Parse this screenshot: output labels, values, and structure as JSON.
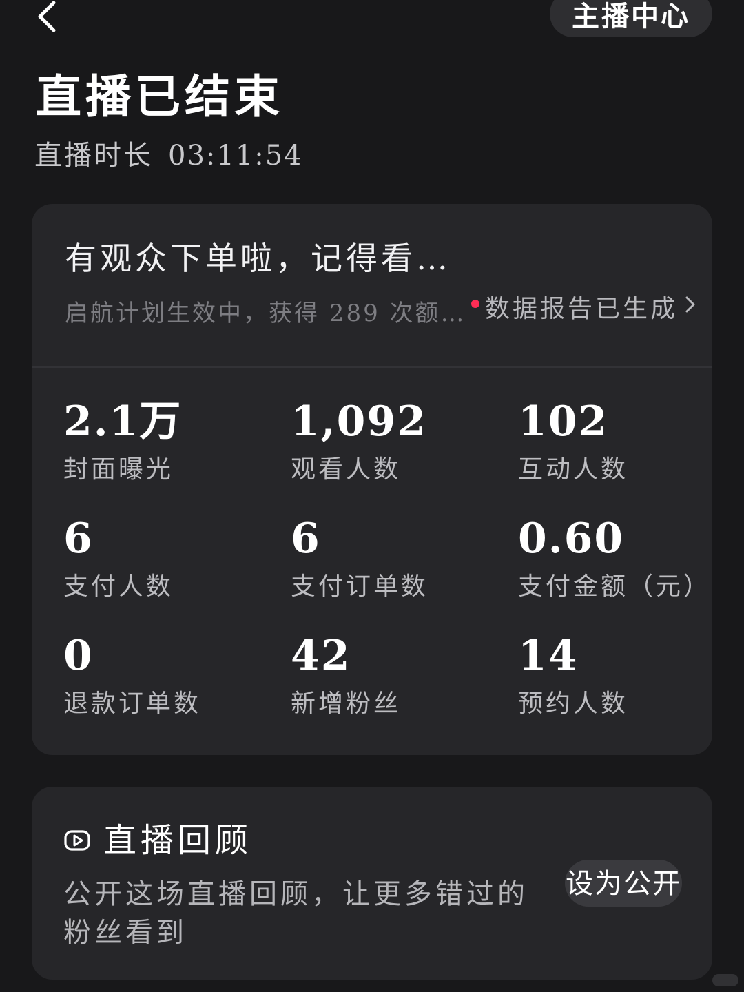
{
  "header": {
    "back_icon": "chevron-left-icon",
    "anchor_center_label": "主播中心"
  },
  "summary": {
    "title": "直播已结束",
    "duration_label": "直播时长",
    "duration_value": "03:11:54"
  },
  "notice": {
    "title": "有观众下单啦，记得看…",
    "subtitle": "启航计划生效中，获得 289 次额…",
    "report_link": "数据报告已生成",
    "report_dot_color": "#ff2d55"
  },
  "metrics": [
    {
      "value": "2.1万",
      "label": "封面曝光"
    },
    {
      "value": "1,092",
      "label": "观看人数"
    },
    {
      "value": "102",
      "label": "互动人数"
    },
    {
      "value": "6",
      "label": "支付人数"
    },
    {
      "value": "6",
      "label": "支付订单数"
    },
    {
      "value": "0.60",
      "label": "支付金额（元）"
    },
    {
      "value": "0",
      "label": "退款订单数"
    },
    {
      "value": "42",
      "label": "新增粉丝"
    },
    {
      "value": "14",
      "label": "预约人数"
    }
  ],
  "replay": {
    "icon": "video-replay-icon",
    "title": "直播回顾",
    "description": "公开这场直播回顾，让更多错过的粉丝看到",
    "button_label": "设为公开"
  },
  "colors": {
    "background": "#18181a",
    "card": "#262629",
    "accent_dot": "#ff2d55"
  }
}
